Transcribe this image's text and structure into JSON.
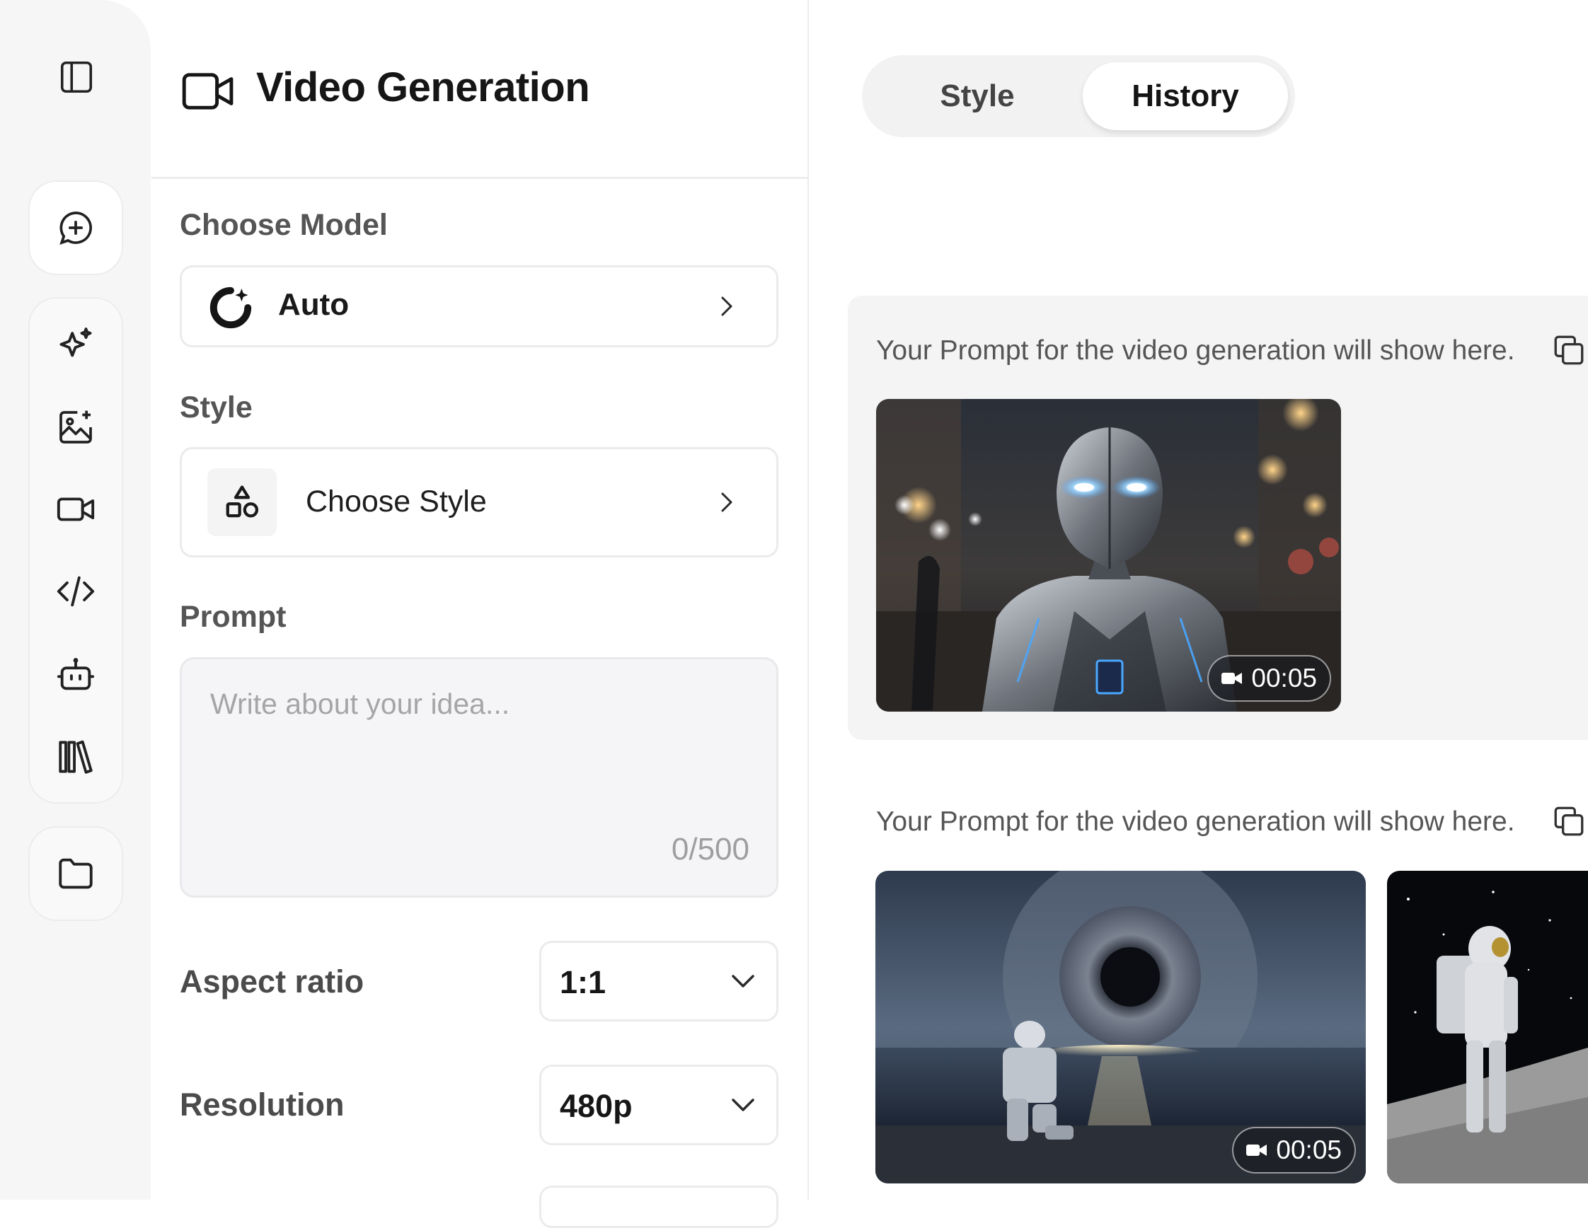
{
  "rail": {
    "icons": [
      "sidebar-toggle-icon",
      "new-chat-icon",
      "sparkle-icon",
      "image-generation-icon",
      "video-camera-icon",
      "code-icon",
      "robot-icon",
      "library-icon",
      "folder-icon"
    ]
  },
  "panel": {
    "title": "Video Generation",
    "model_label": "Choose Model",
    "model_value": "Auto",
    "style_label": "Style",
    "style_value": "Choose Style",
    "prompt_label": "Prompt",
    "prompt_placeholder": "Write about your idea...",
    "prompt_counter": "0/500",
    "aspect_ratio_label": "Aspect ratio",
    "aspect_ratio_value": "1:1",
    "resolution_label": "Resolution",
    "resolution_value": "480p"
  },
  "tabs": {
    "style": "Style",
    "history": "History",
    "active": "History"
  },
  "history": [
    {
      "prompt": "Your Prompt for the video generation will show here.",
      "videos": [
        {
          "duration": "00:05",
          "scene": "chrome android in rainy city street"
        }
      ]
    },
    {
      "prompt": "Your Prompt for the video generation will show here.",
      "videos": [
        {
          "duration": "00:05",
          "scene": "astronaut kneeling on shore facing giant eye planet"
        },
        {
          "duration": "",
          "scene": "astronaut standing on moon surface"
        }
      ]
    }
  ],
  "colors": {
    "rail_bg": "#f6f6f6",
    "accent_text": "#161616",
    "muted_text": "#555555",
    "card_bg": "#f4f4f4"
  }
}
